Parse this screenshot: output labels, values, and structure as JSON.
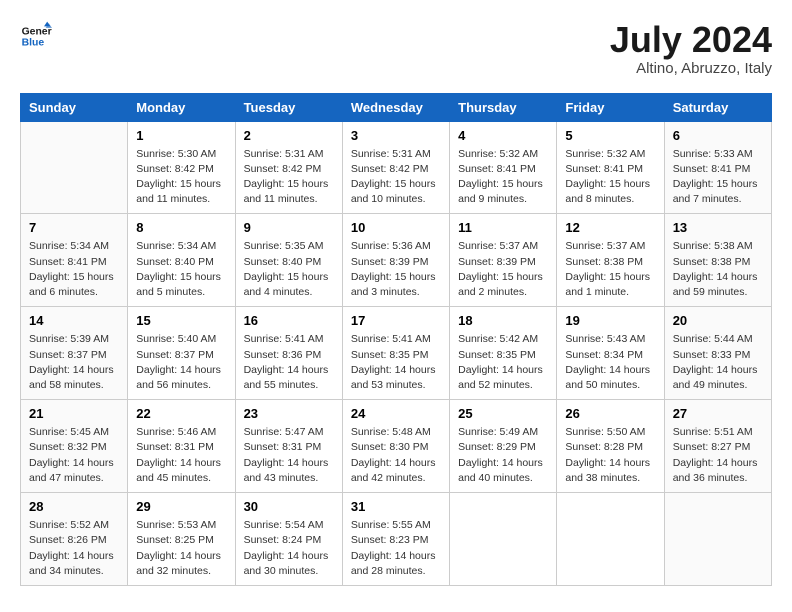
{
  "header": {
    "logo_line1": "General",
    "logo_line2": "Blue",
    "month": "July 2024",
    "location": "Altino, Abruzzo, Italy"
  },
  "weekdays": [
    "Sunday",
    "Monday",
    "Tuesday",
    "Wednesday",
    "Thursday",
    "Friday",
    "Saturday"
  ],
  "weeks": [
    [
      {
        "day": "",
        "sunrise": "",
        "sunset": "",
        "daylight": ""
      },
      {
        "day": "1",
        "sunrise": "Sunrise: 5:30 AM",
        "sunset": "Sunset: 8:42 PM",
        "daylight": "Daylight: 15 hours and 11 minutes."
      },
      {
        "day": "2",
        "sunrise": "Sunrise: 5:31 AM",
        "sunset": "Sunset: 8:42 PM",
        "daylight": "Daylight: 15 hours and 11 minutes."
      },
      {
        "day": "3",
        "sunrise": "Sunrise: 5:31 AM",
        "sunset": "Sunset: 8:42 PM",
        "daylight": "Daylight: 15 hours and 10 minutes."
      },
      {
        "day": "4",
        "sunrise": "Sunrise: 5:32 AM",
        "sunset": "Sunset: 8:41 PM",
        "daylight": "Daylight: 15 hours and 9 minutes."
      },
      {
        "day": "5",
        "sunrise": "Sunrise: 5:32 AM",
        "sunset": "Sunset: 8:41 PM",
        "daylight": "Daylight: 15 hours and 8 minutes."
      },
      {
        "day": "6",
        "sunrise": "Sunrise: 5:33 AM",
        "sunset": "Sunset: 8:41 PM",
        "daylight": "Daylight: 15 hours and 7 minutes."
      }
    ],
    [
      {
        "day": "7",
        "sunrise": "Sunrise: 5:34 AM",
        "sunset": "Sunset: 8:41 PM",
        "daylight": "Daylight: 15 hours and 6 minutes."
      },
      {
        "day": "8",
        "sunrise": "Sunrise: 5:34 AM",
        "sunset": "Sunset: 8:40 PM",
        "daylight": "Daylight: 15 hours and 5 minutes."
      },
      {
        "day": "9",
        "sunrise": "Sunrise: 5:35 AM",
        "sunset": "Sunset: 8:40 PM",
        "daylight": "Daylight: 15 hours and 4 minutes."
      },
      {
        "day": "10",
        "sunrise": "Sunrise: 5:36 AM",
        "sunset": "Sunset: 8:39 PM",
        "daylight": "Daylight: 15 hours and 3 minutes."
      },
      {
        "day": "11",
        "sunrise": "Sunrise: 5:37 AM",
        "sunset": "Sunset: 8:39 PM",
        "daylight": "Daylight: 15 hours and 2 minutes."
      },
      {
        "day": "12",
        "sunrise": "Sunrise: 5:37 AM",
        "sunset": "Sunset: 8:38 PM",
        "daylight": "Daylight: 15 hours and 1 minute."
      },
      {
        "day": "13",
        "sunrise": "Sunrise: 5:38 AM",
        "sunset": "Sunset: 8:38 PM",
        "daylight": "Daylight: 14 hours and 59 minutes."
      }
    ],
    [
      {
        "day": "14",
        "sunrise": "Sunrise: 5:39 AM",
        "sunset": "Sunset: 8:37 PM",
        "daylight": "Daylight: 14 hours and 58 minutes."
      },
      {
        "day": "15",
        "sunrise": "Sunrise: 5:40 AM",
        "sunset": "Sunset: 8:37 PM",
        "daylight": "Daylight: 14 hours and 56 minutes."
      },
      {
        "day": "16",
        "sunrise": "Sunrise: 5:41 AM",
        "sunset": "Sunset: 8:36 PM",
        "daylight": "Daylight: 14 hours and 55 minutes."
      },
      {
        "day": "17",
        "sunrise": "Sunrise: 5:41 AM",
        "sunset": "Sunset: 8:35 PM",
        "daylight": "Daylight: 14 hours and 53 minutes."
      },
      {
        "day": "18",
        "sunrise": "Sunrise: 5:42 AM",
        "sunset": "Sunset: 8:35 PM",
        "daylight": "Daylight: 14 hours and 52 minutes."
      },
      {
        "day": "19",
        "sunrise": "Sunrise: 5:43 AM",
        "sunset": "Sunset: 8:34 PM",
        "daylight": "Daylight: 14 hours and 50 minutes."
      },
      {
        "day": "20",
        "sunrise": "Sunrise: 5:44 AM",
        "sunset": "Sunset: 8:33 PM",
        "daylight": "Daylight: 14 hours and 49 minutes."
      }
    ],
    [
      {
        "day": "21",
        "sunrise": "Sunrise: 5:45 AM",
        "sunset": "Sunset: 8:32 PM",
        "daylight": "Daylight: 14 hours and 47 minutes."
      },
      {
        "day": "22",
        "sunrise": "Sunrise: 5:46 AM",
        "sunset": "Sunset: 8:31 PM",
        "daylight": "Daylight: 14 hours and 45 minutes."
      },
      {
        "day": "23",
        "sunrise": "Sunrise: 5:47 AM",
        "sunset": "Sunset: 8:31 PM",
        "daylight": "Daylight: 14 hours and 43 minutes."
      },
      {
        "day": "24",
        "sunrise": "Sunrise: 5:48 AM",
        "sunset": "Sunset: 8:30 PM",
        "daylight": "Daylight: 14 hours and 42 minutes."
      },
      {
        "day": "25",
        "sunrise": "Sunrise: 5:49 AM",
        "sunset": "Sunset: 8:29 PM",
        "daylight": "Daylight: 14 hours and 40 minutes."
      },
      {
        "day": "26",
        "sunrise": "Sunrise: 5:50 AM",
        "sunset": "Sunset: 8:28 PM",
        "daylight": "Daylight: 14 hours and 38 minutes."
      },
      {
        "day": "27",
        "sunrise": "Sunrise: 5:51 AM",
        "sunset": "Sunset: 8:27 PM",
        "daylight": "Daylight: 14 hours and 36 minutes."
      }
    ],
    [
      {
        "day": "28",
        "sunrise": "Sunrise: 5:52 AM",
        "sunset": "Sunset: 8:26 PM",
        "daylight": "Daylight: 14 hours and 34 minutes."
      },
      {
        "day": "29",
        "sunrise": "Sunrise: 5:53 AM",
        "sunset": "Sunset: 8:25 PM",
        "daylight": "Daylight: 14 hours and 32 minutes."
      },
      {
        "day": "30",
        "sunrise": "Sunrise: 5:54 AM",
        "sunset": "Sunset: 8:24 PM",
        "daylight": "Daylight: 14 hours and 30 minutes."
      },
      {
        "day": "31",
        "sunrise": "Sunrise: 5:55 AM",
        "sunset": "Sunset: 8:23 PM",
        "daylight": "Daylight: 14 hours and 28 minutes."
      },
      {
        "day": "",
        "sunrise": "",
        "sunset": "",
        "daylight": ""
      },
      {
        "day": "",
        "sunrise": "",
        "sunset": "",
        "daylight": ""
      },
      {
        "day": "",
        "sunrise": "",
        "sunset": "",
        "daylight": ""
      }
    ]
  ]
}
